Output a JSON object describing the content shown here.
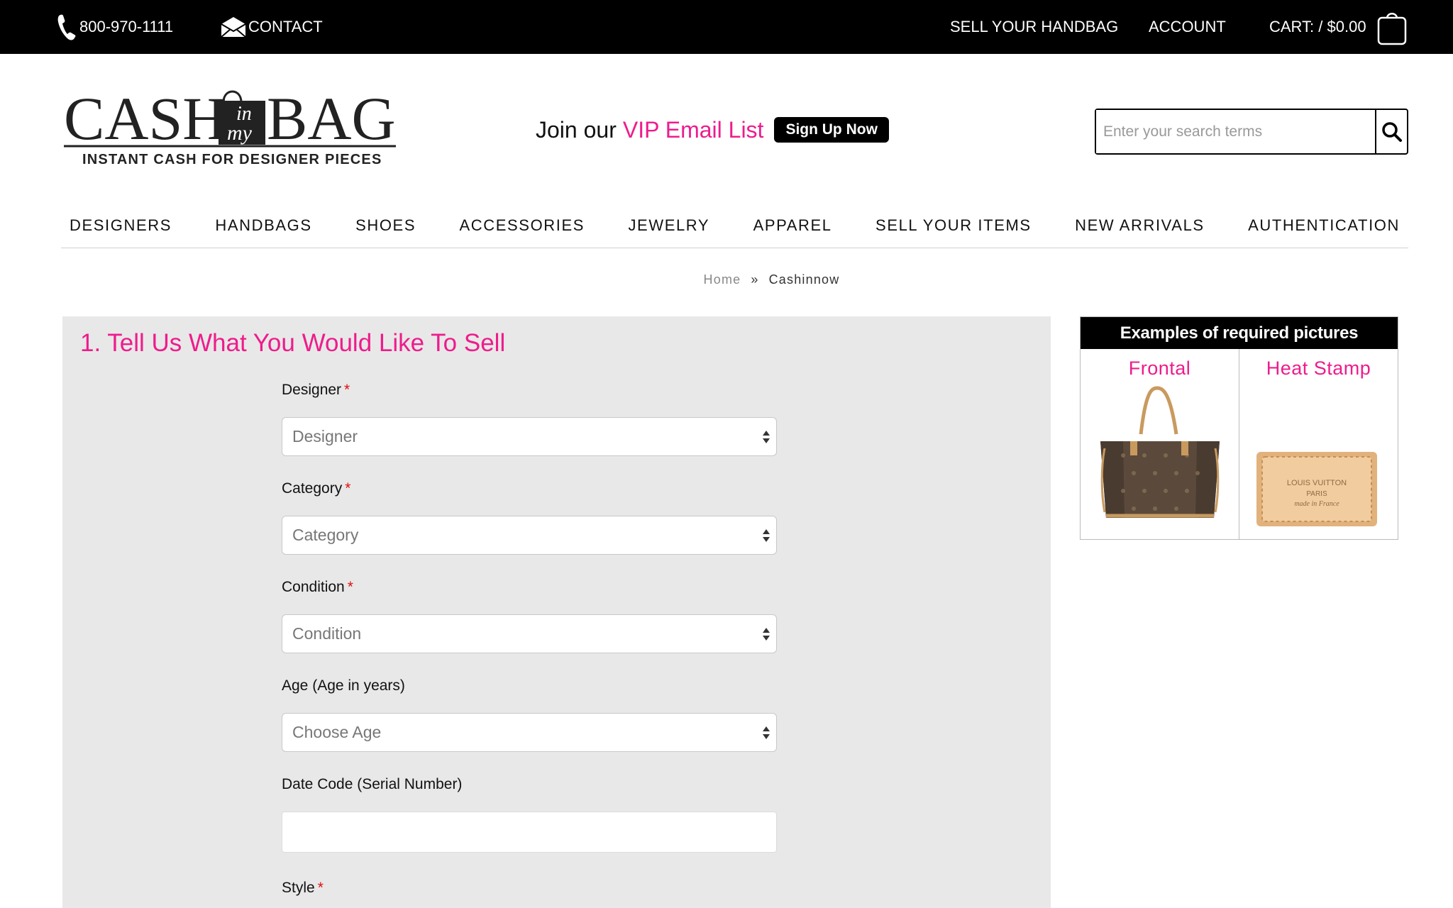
{
  "topbar": {
    "phone": "800-970-1111",
    "contact": "CONTACT",
    "sell_handbag": "SELL YOUR HANDBAG",
    "account": "ACCOUNT",
    "cart": "CART: / $0.00"
  },
  "logo": {
    "word_left": "CASH",
    "word_in": "in",
    "word_my": "my",
    "word_right": "BAG",
    "tagline": "INSTANT CASH FOR DESIGNER PIECES"
  },
  "vip": {
    "prefix": "Join our",
    "highlight": "VIP Email List",
    "button": "Sign Up Now"
  },
  "search": {
    "placeholder": "Enter your search terms"
  },
  "nav": {
    "items": [
      "DESIGNERS",
      "HANDBAGS",
      "SHOES",
      "ACCESSORIES",
      "JEWELRY",
      "APPAREL",
      "SELL YOUR ITEMS",
      "NEW ARRIVALS",
      "AUTHENTICATION"
    ]
  },
  "breadcrumb": {
    "home": "Home",
    "separator": "»",
    "current": "Cashinnow"
  },
  "form": {
    "title": "1. Tell Us What You Would Like To Sell",
    "designer_label": "Designer",
    "designer_value": "Designer",
    "category_label": "Category",
    "category_value": "Category",
    "condition_label": "Condition",
    "condition_value": "Condition",
    "age_label": "Age (Age in years)",
    "age_value": "Choose Age",
    "datecode_label": "Date Code (Serial Number)",
    "datecode_value": "",
    "style_label": "Style",
    "required_mark": "*"
  },
  "examples": {
    "title": "Examples of required pictures",
    "frontal": "Frontal",
    "heat_stamp": "Heat Stamp",
    "stamp_line1": "LOUIS VUITTON",
    "stamp_line2": "PARIS",
    "stamp_line3": "made in France"
  },
  "colors": {
    "accent_pink": "#ee1c8c",
    "topbar_bg": "#000000",
    "panel_bg": "#e8e8e8",
    "required_red": "#e01010"
  }
}
